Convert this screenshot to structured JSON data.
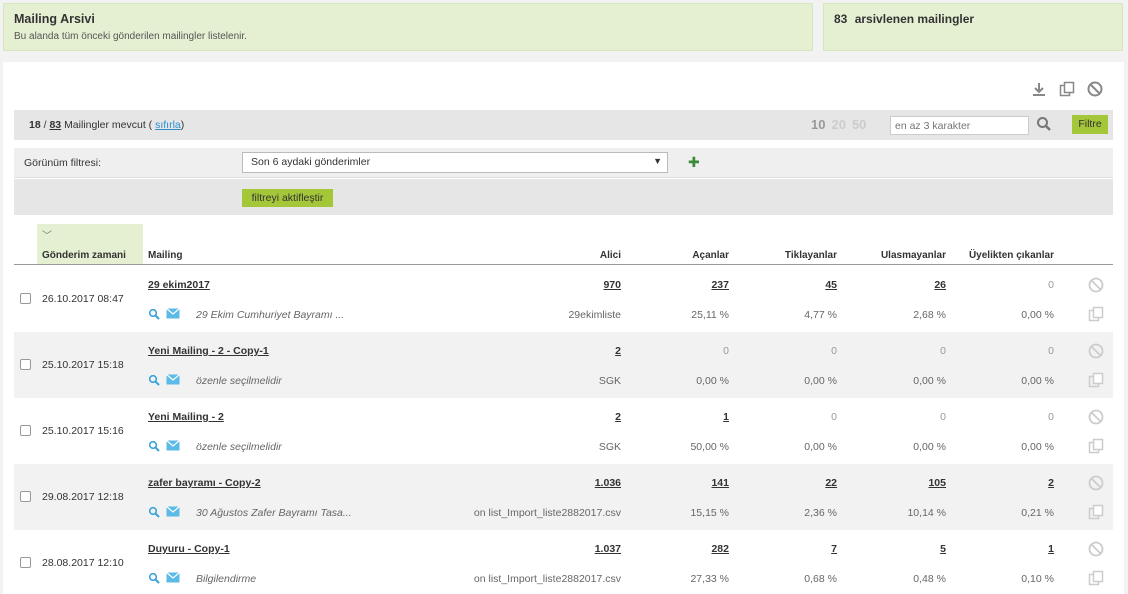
{
  "header": {
    "title": "Mailing Arsivi",
    "subtitle": "Bu alanda tüm önceki gönderilen mailingler listelenir.",
    "archived_count": "83",
    "archived_label": "arsivlenen mailingler"
  },
  "toolbar": {
    "shown": "18",
    "total": "83",
    "label": "Mailingler  mevcut (",
    "reset": "sıfırla",
    "close": ")",
    "page_sizes": [
      "10",
      "20",
      "50"
    ],
    "search_placeholder": "en az 3 karakter",
    "filter_label": "Filtre"
  },
  "view_filter": {
    "label": "Görünüm filtresi:",
    "selected": "Son 6 aydaki gönderimler",
    "activate_label": "filtreyi aktifleştir"
  },
  "columns": {
    "date": "Gönderim zamani",
    "mailing": "Mailing",
    "recipients": "Alici",
    "opens": "Açanlar",
    "clicks": "Tiklayanlar",
    "bounces": "Ulasmayanlar",
    "unsubs": "Üyelikten çıkanlar"
  },
  "rows": [
    {
      "date": "26.10.2017 08:47",
      "name": "29 ekim2017",
      "desc": "29 Ekim Cumhuriyet Bayramı ...",
      "recipients": "970",
      "list": "29ekimliste",
      "opens": "237",
      "opens_pct": "25,11 %",
      "clicks": "45",
      "clicks_pct": "4,77 %",
      "bounces": "26",
      "bounces_pct": "2,68 %",
      "unsubs": "0",
      "unsubs_pct": "0,00 %"
    },
    {
      "date": "25.10.2017 15:18",
      "name": "Yeni Mailing - 2 - Copy-1",
      "desc": "özenle seçilmelidir",
      "recipients": "2",
      "list": "SGK",
      "opens": "0",
      "opens_pct": "0,00 %",
      "clicks": "0",
      "clicks_pct": "0,00 %",
      "bounces": "0",
      "bounces_pct": "0,00 %",
      "unsubs": "0",
      "unsubs_pct": "0,00 %"
    },
    {
      "date": "25.10.2017 15:16",
      "name": "Yeni Mailing - 2",
      "desc": "özenle seçilmelidir",
      "recipients": "2",
      "list": "SGK",
      "opens": "1",
      "opens_pct": "50,00 %",
      "clicks": "0",
      "clicks_pct": "0,00 %",
      "bounces": "0",
      "bounces_pct": "0,00 %",
      "unsubs": "0",
      "unsubs_pct": "0,00 %"
    },
    {
      "date": "29.08.2017 12:18",
      "name": "zafer bayramı - Copy-2",
      "desc": "30 Ağustos Zafer Bayramı Tasa...",
      "recipients": "1.036",
      "list": "on list_Import_liste2882017.csv",
      "opens": "141",
      "opens_pct": "15,15 %",
      "clicks": "22",
      "clicks_pct": "2,36 %",
      "bounces": "105",
      "bounces_pct": "10,14 %",
      "unsubs": "2",
      "unsubs_pct": "0,21 %"
    },
    {
      "date": "28.08.2017 12:10",
      "name": "Duyuru - Copy-1",
      "desc": "Bilgilendirme",
      "recipients": "1.037",
      "list": "on list_Import_liste2882017.csv",
      "opens": "282",
      "opens_pct": "27,33 %",
      "clicks": "7",
      "clicks_pct": "0,68 %",
      "bounces": "5",
      "bounces_pct": "0,48 %",
      "unsubs": "1",
      "unsubs_pct": "0,10 %"
    }
  ]
}
